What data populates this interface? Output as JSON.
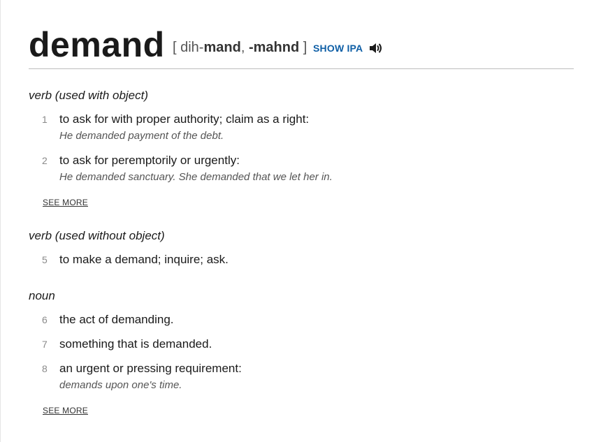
{
  "entry": {
    "word": "demand",
    "pron_open": "[",
    "pron_s1": " dih-",
    "pron_s2": "mand",
    "pron_comma": ", ",
    "pron_s3": "-mahnd",
    "pron_close": " ]",
    "show_ipa": "SHOW IPA",
    "audio_icon": "speaker-icon"
  },
  "sections": {
    "s1": {
      "pos": "verb (used with object)",
      "defs": [
        {
          "num": "1",
          "text": "to ask for with proper authority; claim as a right:",
          "example": "He demanded payment of the debt."
        },
        {
          "num": "2",
          "text": "to ask for peremptorily or urgently:",
          "example": "He demanded sanctuary. She demanded that we let her in."
        }
      ],
      "see_more": "SEE MORE"
    },
    "s2": {
      "pos": "verb (used without object)",
      "defs": [
        {
          "num": "5",
          "text": "to make a demand; inquire; ask."
        }
      ]
    },
    "s3": {
      "pos": "noun",
      "defs": [
        {
          "num": "6",
          "text": "the act of demanding."
        },
        {
          "num": "7",
          "text": "something that is demanded."
        },
        {
          "num": "8",
          "text": "an urgent or pressing requirement:",
          "example": "demands upon one's time."
        }
      ],
      "see_more": "SEE MORE"
    }
  }
}
